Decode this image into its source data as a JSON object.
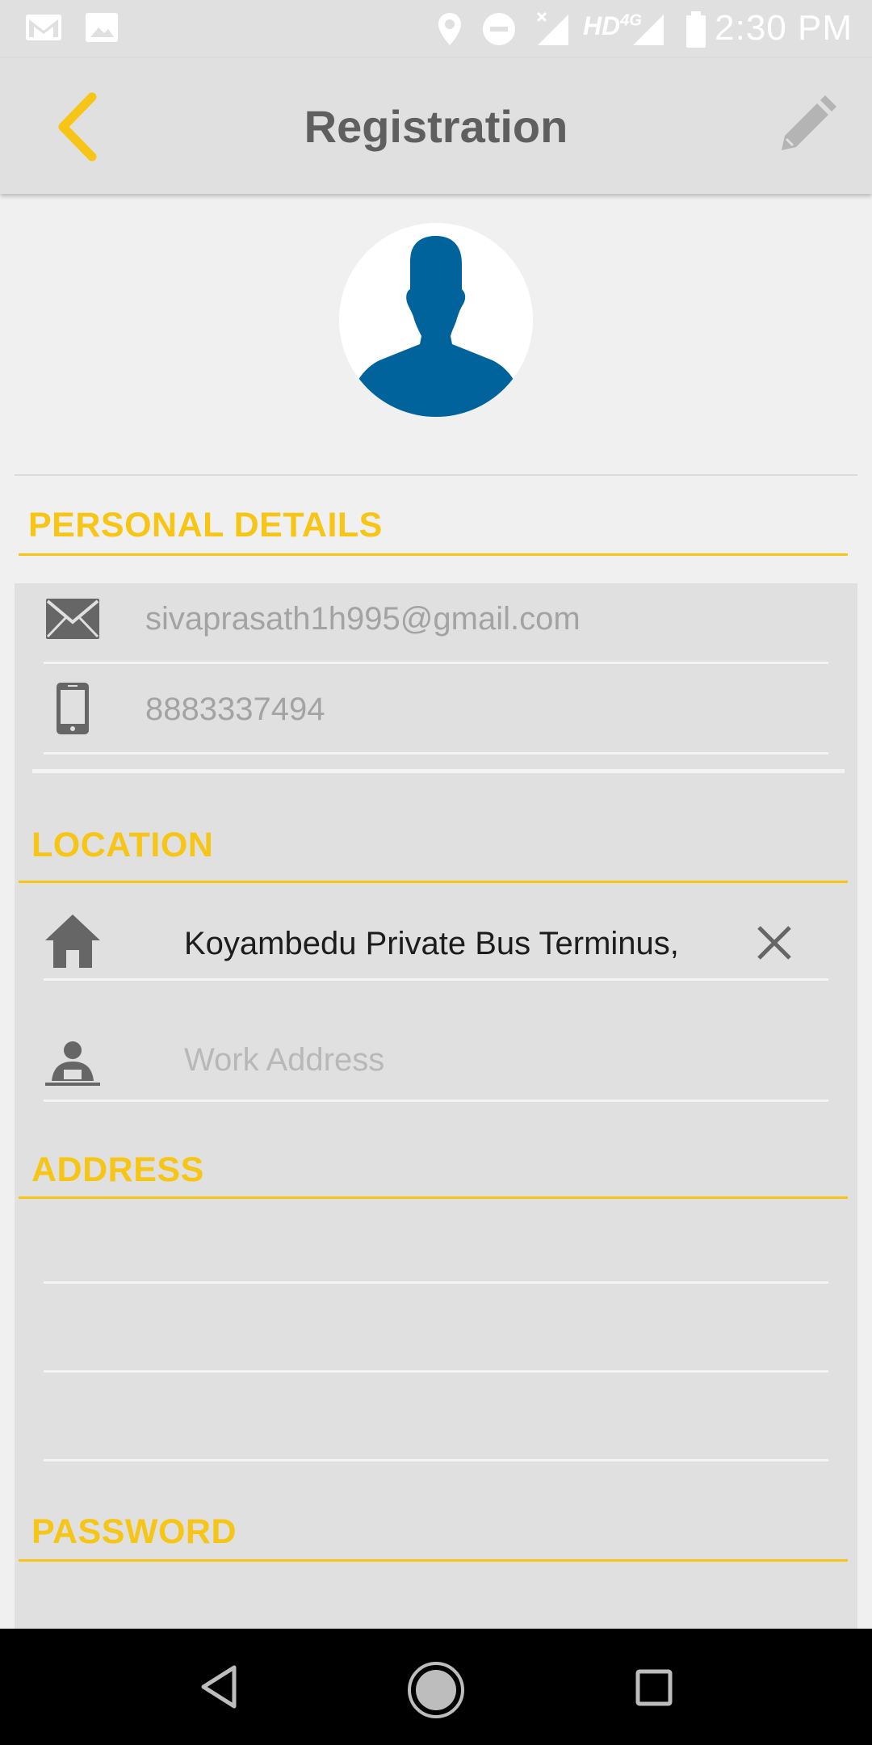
{
  "status_bar": {
    "time": "2:30 PM",
    "network": "HD",
    "network_type": "4G",
    "icons": [
      "gmail-icon",
      "gallery-icon",
      "location-icon",
      "do-not-disturb-icon",
      "signal-no-data-icon",
      "signal-icon",
      "battery-icon"
    ]
  },
  "app_bar": {
    "title": "Registration",
    "back_icon": "chevron-left-icon",
    "edit_icon": "pencil-icon"
  },
  "profile": {
    "avatar_icon": "person-silhouette-icon"
  },
  "personal_details": {
    "heading": "PERSONAL DETAILS",
    "email": "sivaprasath1h995@gmail.com",
    "phone": "8883337494"
  },
  "location": {
    "heading": "LOCATION",
    "home_value": "Koyambedu Private Bus Terminus,",
    "work_placeholder": "Work Address"
  },
  "address": {
    "heading": "ADDRESS",
    "line1": "",
    "line2": "",
    "line3": ""
  },
  "password": {
    "heading": "PASSWORD"
  },
  "colors": {
    "accent": "#f6c516",
    "appbar_bg": "#e0e0e0",
    "avatar_blue": "#00639c",
    "page_bg": "#f0f0f0"
  }
}
